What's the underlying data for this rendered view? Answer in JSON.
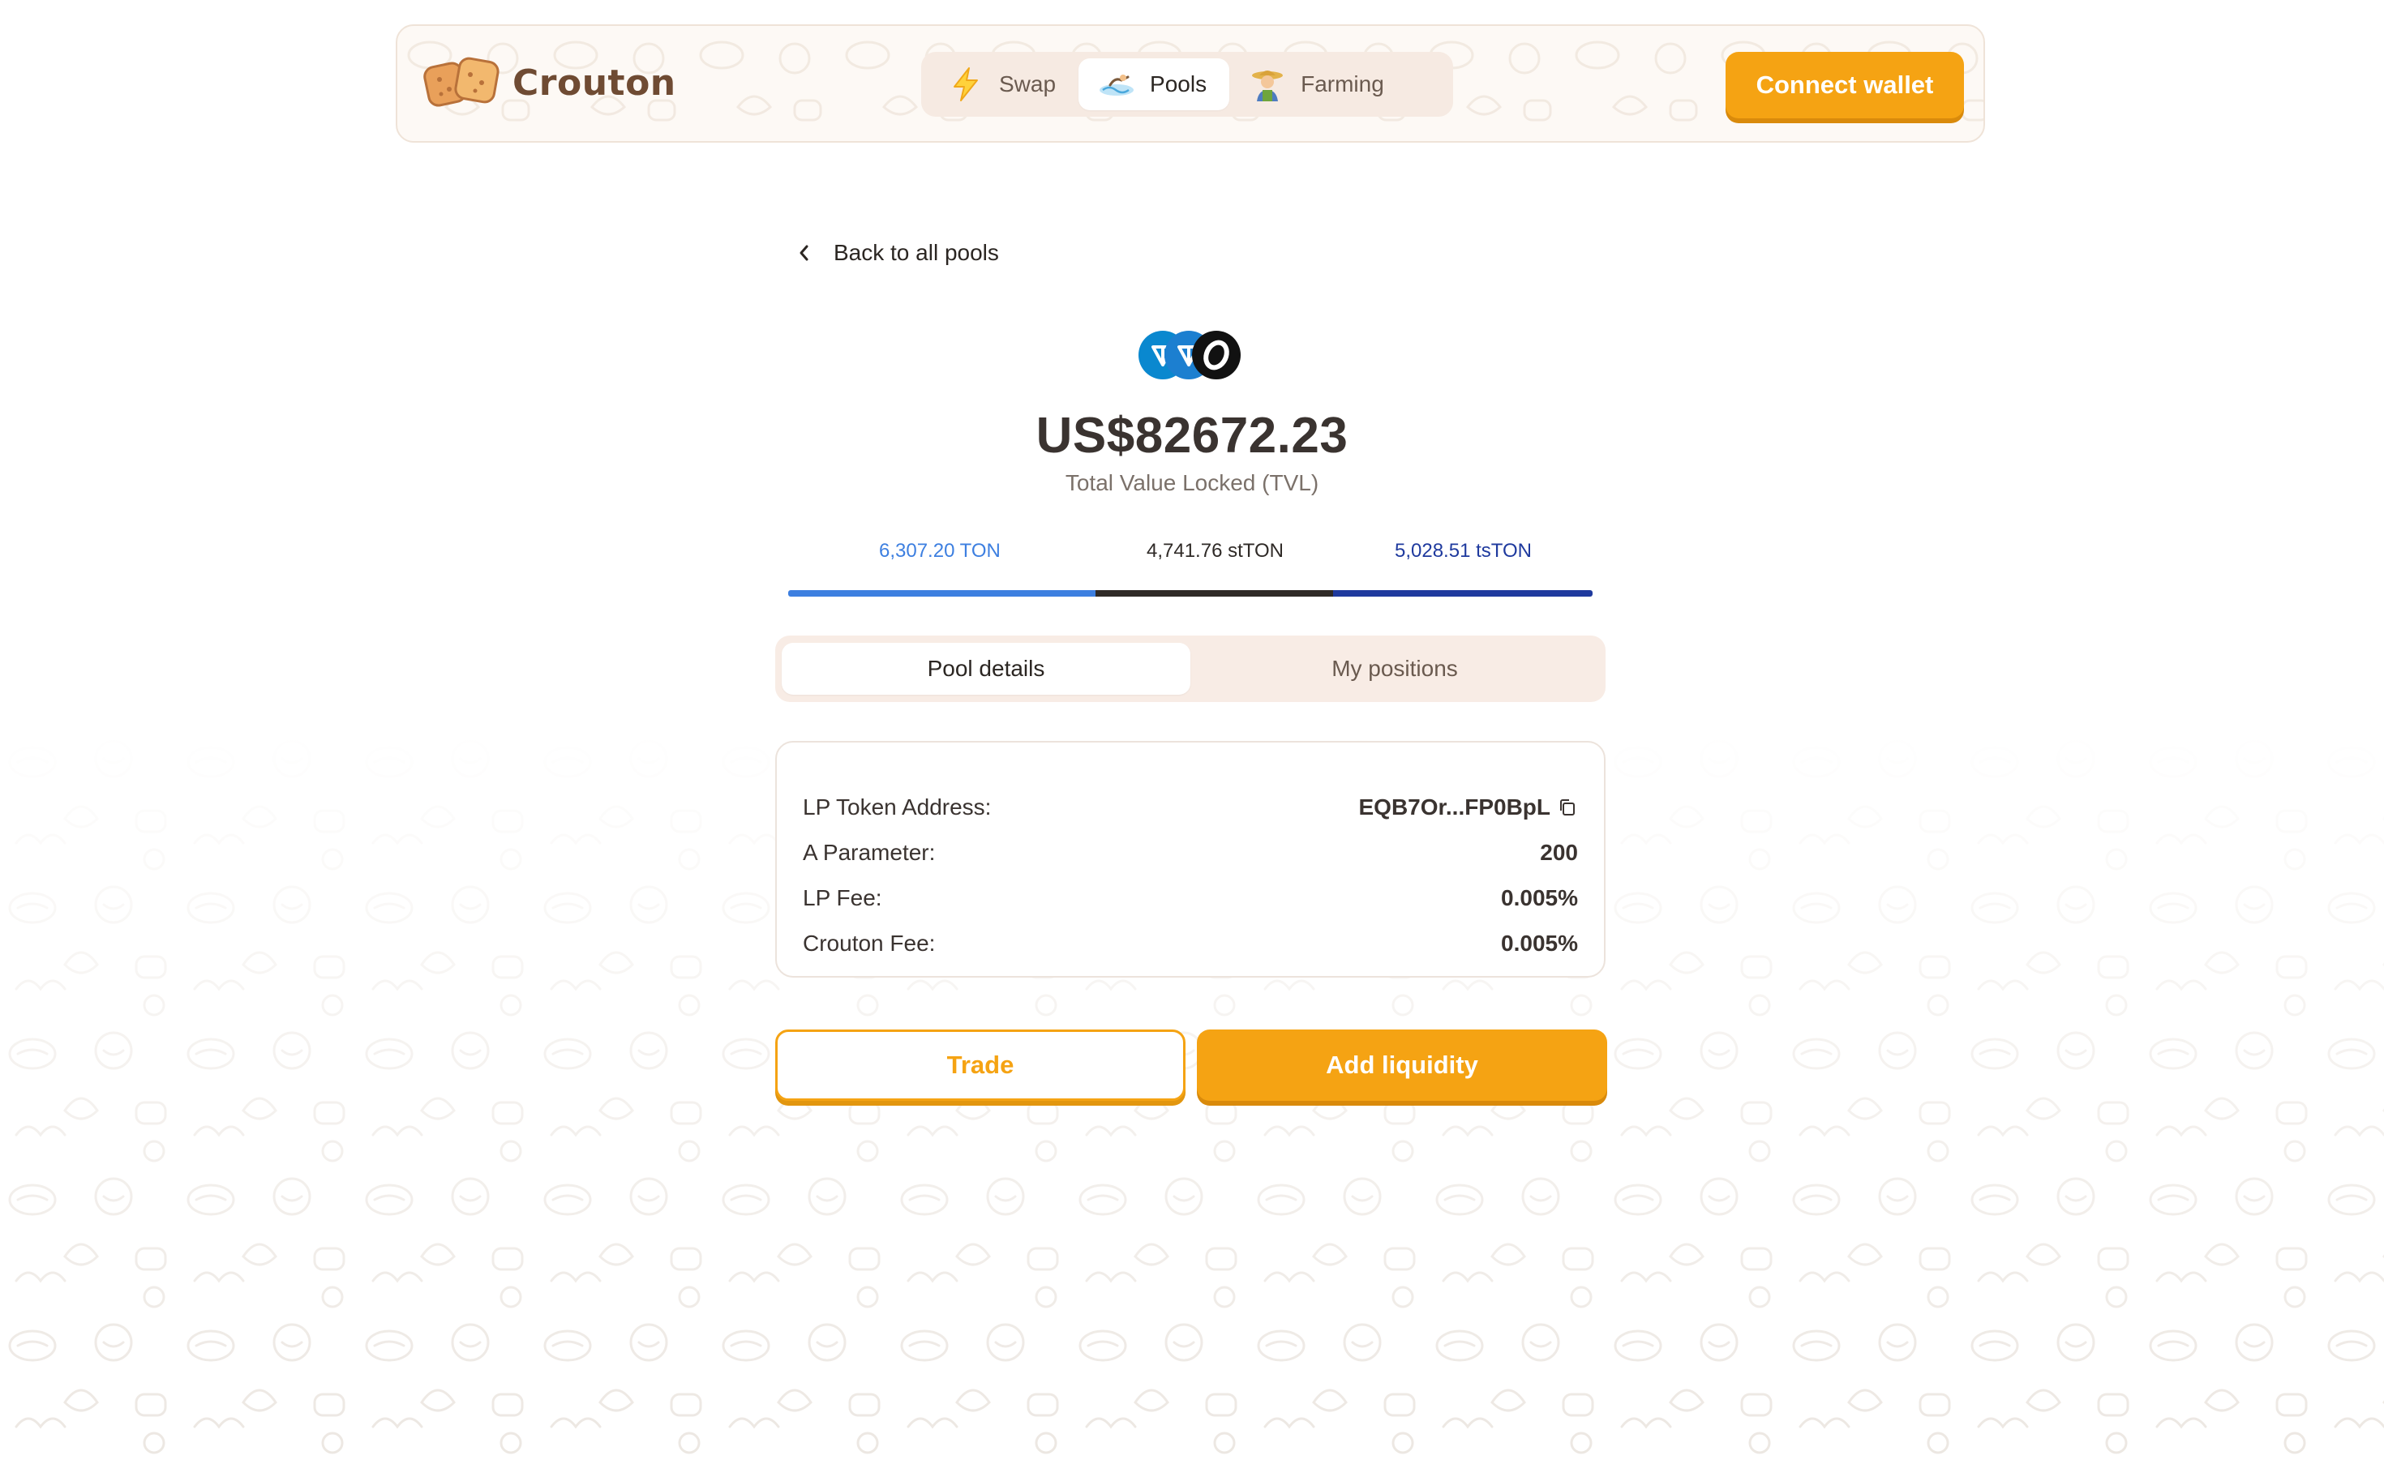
{
  "colors": {
    "accent": "#f5a313",
    "accent_shadow": "#d98a0b",
    "brand_brown": "#6f4b33",
    "nav_bg": "#f6eae2",
    "tab_bg": "#f8ece5",
    "ton_blue": "#3d7fe0",
    "stton_dark": "#2f2a27",
    "tston_navy": "#1f3a9e"
  },
  "header": {
    "logo_text": "Crouton",
    "nav": [
      {
        "label": "Swap",
        "icon": "lightning-icon",
        "active": false
      },
      {
        "label": "Pools",
        "icon": "pool-icon",
        "active": true
      },
      {
        "label": "Farming",
        "icon": "farmer-icon",
        "active": false
      }
    ],
    "connect_wallet_label": "Connect wallet"
  },
  "back_link": {
    "label": "Back to all pools"
  },
  "pool": {
    "token_icons": [
      "ton-icon",
      "tston-icon",
      "stton-icon"
    ],
    "tvl_value": "US$82672.23",
    "tvl_label": "Total Value Locked (TVL)",
    "reserves": [
      {
        "label": "6,307.20 TON",
        "share": 0.3824,
        "color": "#3d7fe0"
      },
      {
        "label": "4,741.76 stTON",
        "share": 0.2952,
        "color": "#2f2a27"
      },
      {
        "label": "5,028.51 tsTON",
        "share": 0.3224,
        "color": "#1f3a9e"
      }
    ]
  },
  "tabs": [
    {
      "label": "Pool details",
      "active": true
    },
    {
      "label": "My positions",
      "active": false
    }
  ],
  "details": {
    "rows": [
      {
        "label": "LP Token Address:",
        "value": "EQB7Or...FP0BpL",
        "copyable": true
      },
      {
        "label": "A Parameter:",
        "value": "200"
      },
      {
        "label": "LP Fee:",
        "value": "0.005%"
      },
      {
        "label": "Crouton Fee:",
        "value": "0.005%"
      }
    ]
  },
  "actions": {
    "trade_label": "Trade",
    "add_liquidity_label": "Add liquidity"
  }
}
